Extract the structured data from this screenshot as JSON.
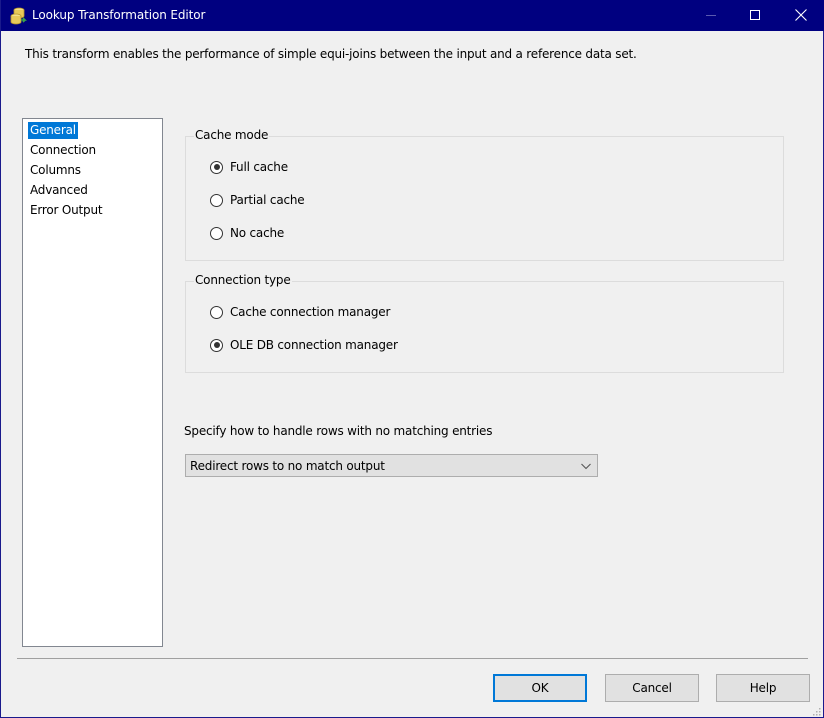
{
  "window": {
    "title": "Lookup Transformation Editor",
    "icon": "database-lookup-icon",
    "controls": {
      "minimize": "minimize-icon",
      "maximize": "maximize-icon",
      "close": "close-icon"
    }
  },
  "description": "This transform enables the performance of simple equi-joins between the input and a reference data set.",
  "nav": {
    "items": [
      {
        "label": "General",
        "selected": true
      },
      {
        "label": "Connection",
        "selected": false
      },
      {
        "label": "Columns",
        "selected": false
      },
      {
        "label": "Advanced",
        "selected": false
      },
      {
        "label": "Error Output",
        "selected": false
      }
    ]
  },
  "cache_mode": {
    "label": "Cache mode",
    "options": [
      {
        "label": "Full cache",
        "checked": true
      },
      {
        "label": "Partial cache",
        "checked": false
      },
      {
        "label": "No cache",
        "checked": false
      }
    ]
  },
  "connection_type": {
    "label": "Connection type",
    "options": [
      {
        "label": "Cache connection manager",
        "checked": false
      },
      {
        "label": "OLE DB connection manager",
        "checked": true
      }
    ]
  },
  "no_match": {
    "label": "Specify how to handle rows with no matching entries",
    "selected": "Redirect rows to no match output"
  },
  "buttons": {
    "ok": "OK",
    "cancel": "Cancel",
    "help": "Help"
  },
  "colors": {
    "titlebar": "#000080",
    "selection": "#0078d7",
    "background": "#f0f0f0"
  }
}
